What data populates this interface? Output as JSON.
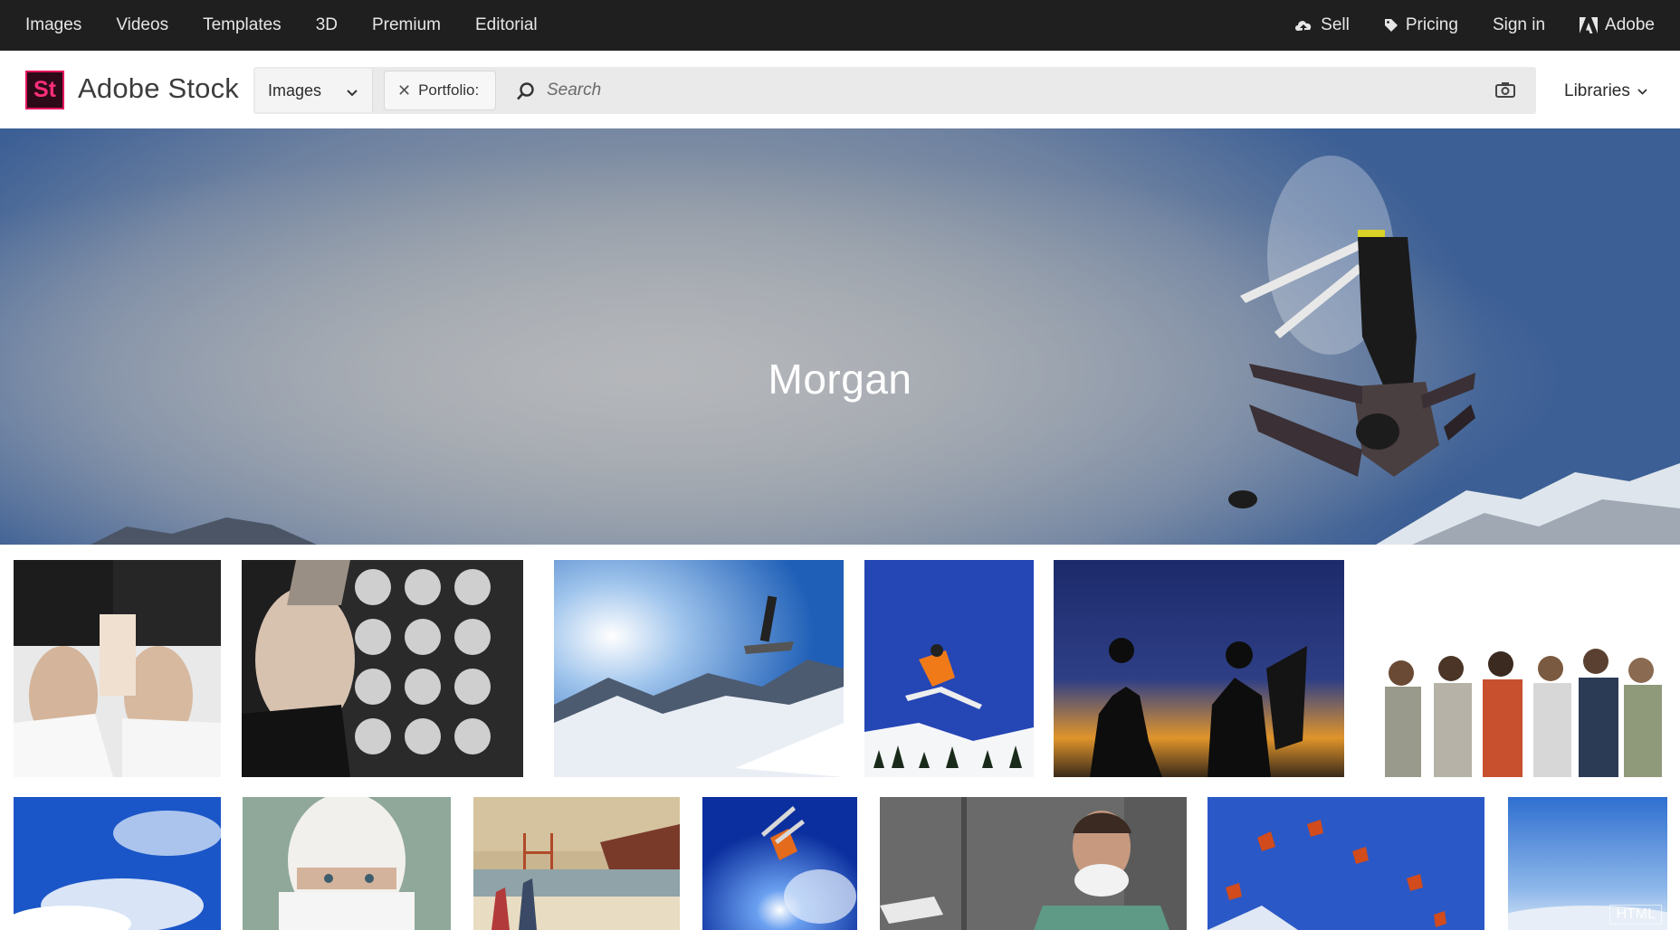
{
  "topnav": {
    "left": [
      {
        "label": "Images"
      },
      {
        "label": "Videos"
      },
      {
        "label": "Templates"
      },
      {
        "label": "3D"
      },
      {
        "label": "Premium"
      },
      {
        "label": "Editorial"
      }
    ],
    "sell": "Sell",
    "pricing": "Pricing",
    "signin": "Sign in",
    "adobe": "Adobe"
  },
  "header": {
    "logo_text": "St",
    "brand": "Adobe Stock",
    "type_select": "Images",
    "chip_label": "Portfolio:",
    "search_placeholder": "Search",
    "libraries": "Libraries"
  },
  "hero": {
    "title": "Morgan"
  },
  "grid": {
    "row1": [
      {
        "subject": "doctors-xray"
      },
      {
        "subject": "doctor-scans"
      },
      {
        "subject": "skier-mountains"
      },
      {
        "subject": "skier-orange-jump"
      },
      {
        "subject": "sunset-silhouettes"
      },
      {
        "subject": "friends-hugging"
      }
    ],
    "row2": [
      {
        "subject": "sky-clouds"
      },
      {
        "subject": "surgeon-mask"
      },
      {
        "subject": "beach-family"
      },
      {
        "subject": "skier-sun"
      },
      {
        "subject": "doctor-mask"
      },
      {
        "subject": "skydivers"
      },
      {
        "subject": "sky-horizon"
      }
    ]
  },
  "watermark": "HTML"
}
